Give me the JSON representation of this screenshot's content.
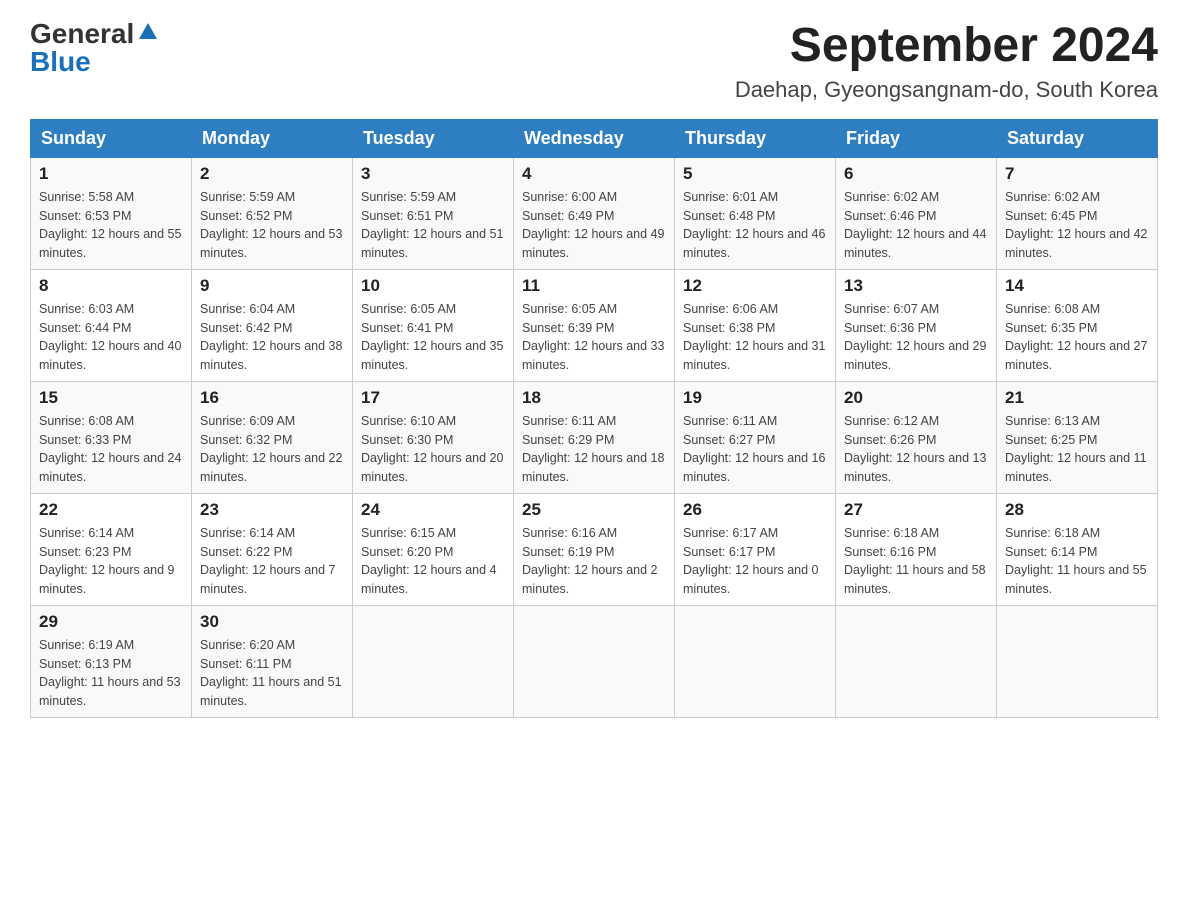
{
  "logo": {
    "general": "General",
    "blue": "Blue"
  },
  "title": "September 2024",
  "subtitle": "Daehap, Gyeongsangnam-do, South Korea",
  "weekdays": [
    "Sunday",
    "Monday",
    "Tuesday",
    "Wednesday",
    "Thursday",
    "Friday",
    "Saturday"
  ],
  "weeks": [
    [
      {
        "day": "1",
        "sunrise": "Sunrise: 5:58 AM",
        "sunset": "Sunset: 6:53 PM",
        "daylight": "Daylight: 12 hours and 55 minutes."
      },
      {
        "day": "2",
        "sunrise": "Sunrise: 5:59 AM",
        "sunset": "Sunset: 6:52 PM",
        "daylight": "Daylight: 12 hours and 53 minutes."
      },
      {
        "day": "3",
        "sunrise": "Sunrise: 5:59 AM",
        "sunset": "Sunset: 6:51 PM",
        "daylight": "Daylight: 12 hours and 51 minutes."
      },
      {
        "day": "4",
        "sunrise": "Sunrise: 6:00 AM",
        "sunset": "Sunset: 6:49 PM",
        "daylight": "Daylight: 12 hours and 49 minutes."
      },
      {
        "day": "5",
        "sunrise": "Sunrise: 6:01 AM",
        "sunset": "Sunset: 6:48 PM",
        "daylight": "Daylight: 12 hours and 46 minutes."
      },
      {
        "day": "6",
        "sunrise": "Sunrise: 6:02 AM",
        "sunset": "Sunset: 6:46 PM",
        "daylight": "Daylight: 12 hours and 44 minutes."
      },
      {
        "day": "7",
        "sunrise": "Sunrise: 6:02 AM",
        "sunset": "Sunset: 6:45 PM",
        "daylight": "Daylight: 12 hours and 42 minutes."
      }
    ],
    [
      {
        "day": "8",
        "sunrise": "Sunrise: 6:03 AM",
        "sunset": "Sunset: 6:44 PM",
        "daylight": "Daylight: 12 hours and 40 minutes."
      },
      {
        "day": "9",
        "sunrise": "Sunrise: 6:04 AM",
        "sunset": "Sunset: 6:42 PM",
        "daylight": "Daylight: 12 hours and 38 minutes."
      },
      {
        "day": "10",
        "sunrise": "Sunrise: 6:05 AM",
        "sunset": "Sunset: 6:41 PM",
        "daylight": "Daylight: 12 hours and 35 minutes."
      },
      {
        "day": "11",
        "sunrise": "Sunrise: 6:05 AM",
        "sunset": "Sunset: 6:39 PM",
        "daylight": "Daylight: 12 hours and 33 minutes."
      },
      {
        "day": "12",
        "sunrise": "Sunrise: 6:06 AM",
        "sunset": "Sunset: 6:38 PM",
        "daylight": "Daylight: 12 hours and 31 minutes."
      },
      {
        "day": "13",
        "sunrise": "Sunrise: 6:07 AM",
        "sunset": "Sunset: 6:36 PM",
        "daylight": "Daylight: 12 hours and 29 minutes."
      },
      {
        "day": "14",
        "sunrise": "Sunrise: 6:08 AM",
        "sunset": "Sunset: 6:35 PM",
        "daylight": "Daylight: 12 hours and 27 minutes."
      }
    ],
    [
      {
        "day": "15",
        "sunrise": "Sunrise: 6:08 AM",
        "sunset": "Sunset: 6:33 PM",
        "daylight": "Daylight: 12 hours and 24 minutes."
      },
      {
        "day": "16",
        "sunrise": "Sunrise: 6:09 AM",
        "sunset": "Sunset: 6:32 PM",
        "daylight": "Daylight: 12 hours and 22 minutes."
      },
      {
        "day": "17",
        "sunrise": "Sunrise: 6:10 AM",
        "sunset": "Sunset: 6:30 PM",
        "daylight": "Daylight: 12 hours and 20 minutes."
      },
      {
        "day": "18",
        "sunrise": "Sunrise: 6:11 AM",
        "sunset": "Sunset: 6:29 PM",
        "daylight": "Daylight: 12 hours and 18 minutes."
      },
      {
        "day": "19",
        "sunrise": "Sunrise: 6:11 AM",
        "sunset": "Sunset: 6:27 PM",
        "daylight": "Daylight: 12 hours and 16 minutes."
      },
      {
        "day": "20",
        "sunrise": "Sunrise: 6:12 AM",
        "sunset": "Sunset: 6:26 PM",
        "daylight": "Daylight: 12 hours and 13 minutes."
      },
      {
        "day": "21",
        "sunrise": "Sunrise: 6:13 AM",
        "sunset": "Sunset: 6:25 PM",
        "daylight": "Daylight: 12 hours and 11 minutes."
      }
    ],
    [
      {
        "day": "22",
        "sunrise": "Sunrise: 6:14 AM",
        "sunset": "Sunset: 6:23 PM",
        "daylight": "Daylight: 12 hours and 9 minutes."
      },
      {
        "day": "23",
        "sunrise": "Sunrise: 6:14 AM",
        "sunset": "Sunset: 6:22 PM",
        "daylight": "Daylight: 12 hours and 7 minutes."
      },
      {
        "day": "24",
        "sunrise": "Sunrise: 6:15 AM",
        "sunset": "Sunset: 6:20 PM",
        "daylight": "Daylight: 12 hours and 4 minutes."
      },
      {
        "day": "25",
        "sunrise": "Sunrise: 6:16 AM",
        "sunset": "Sunset: 6:19 PM",
        "daylight": "Daylight: 12 hours and 2 minutes."
      },
      {
        "day": "26",
        "sunrise": "Sunrise: 6:17 AM",
        "sunset": "Sunset: 6:17 PM",
        "daylight": "Daylight: 12 hours and 0 minutes."
      },
      {
        "day": "27",
        "sunrise": "Sunrise: 6:18 AM",
        "sunset": "Sunset: 6:16 PM",
        "daylight": "Daylight: 11 hours and 58 minutes."
      },
      {
        "day": "28",
        "sunrise": "Sunrise: 6:18 AM",
        "sunset": "Sunset: 6:14 PM",
        "daylight": "Daylight: 11 hours and 55 minutes."
      }
    ],
    [
      {
        "day": "29",
        "sunrise": "Sunrise: 6:19 AM",
        "sunset": "Sunset: 6:13 PM",
        "daylight": "Daylight: 11 hours and 53 minutes."
      },
      {
        "day": "30",
        "sunrise": "Sunrise: 6:20 AM",
        "sunset": "Sunset: 6:11 PM",
        "daylight": "Daylight: 11 hours and 51 minutes."
      },
      null,
      null,
      null,
      null,
      null
    ]
  ]
}
